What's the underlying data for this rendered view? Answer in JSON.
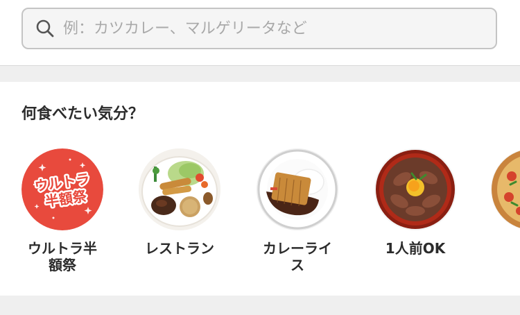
{
  "search": {
    "placeholder": "例：カツカレー、マルゲリータなど",
    "value": ""
  },
  "categories_section": {
    "title": "何食べたい気分？",
    "items": [
      {
        "label": "ウルトラ半額祭",
        "badge_line1": "ウルトラ",
        "badge_line2": "半額祭",
        "icon": "ultra-half-price-badge"
      },
      {
        "label": "レストラン",
        "icon": "restaurant-plate"
      },
      {
        "label": "カレーライス",
        "icon": "curry-rice-plate"
      },
      {
        "label": "1人前OK",
        "icon": "single-serving-bowl"
      },
      {
        "label": "",
        "icon": "pizza"
      }
    ]
  },
  "colors": {
    "accent": "#e84a3d",
    "text": "#2b2b2b",
    "placeholder": "#a9a9a9",
    "border": "#c4c4c4",
    "background": "#efefef"
  }
}
